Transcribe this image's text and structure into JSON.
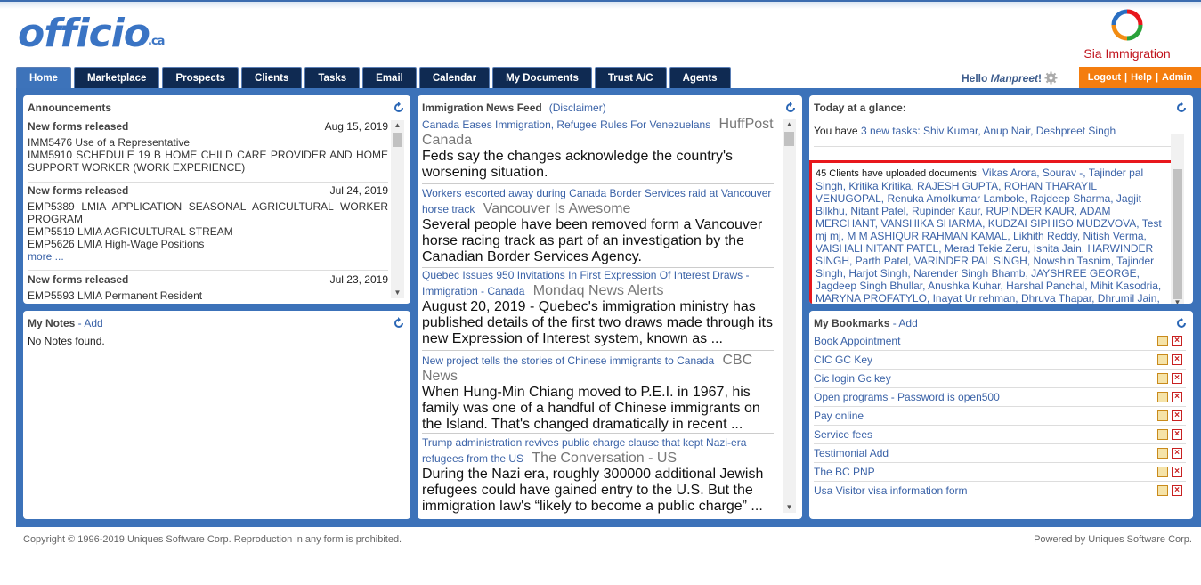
{
  "brand": {
    "logo": "officio",
    "logo_suffix": ".ca",
    "company": "Sia Immigration"
  },
  "nav": {
    "tabs": [
      "Home",
      "Marketplace",
      "Prospects",
      "Clients",
      "Tasks",
      "Email",
      "Calendar",
      "My Documents",
      "Trust A/C",
      "Agents"
    ],
    "active": "Home",
    "hello_prefix": "Hello ",
    "user": "Manpreet",
    "hello_suffix": "!",
    "logout": "Logout",
    "help": "Help",
    "admin": "Admin",
    "sep": "|"
  },
  "announcements": {
    "title": "Announcements",
    "items": [
      {
        "heading": "New forms released",
        "date": "Aug 15, 2019",
        "lines": [
          "IMM5476 Use of a Representative",
          "IMM5910 SCHEDULE 19 B HOME CHILD CARE PROVIDER AND HOME SUPPORT WORKER (WORK EXPERIENCE)"
        ]
      },
      {
        "heading": "New forms released",
        "date": "Jul 24, 2019",
        "lines": [
          "EMP5389 LMIA APPLICATION SEASONAL AGRICULTURAL WORKER PROGRAM",
          "EMP5519 LMIA AGRICULTURAL STREAM",
          "EMP5626 LMIA High-Wage Positions"
        ],
        "more": "more ..."
      },
      {
        "heading": "New forms released",
        "date": "Jul 23, 2019",
        "lines": [
          "EMP5593 LMIA Permanent Resident"
        ]
      }
    ]
  },
  "notes": {
    "title": "My Notes",
    "add": "Add",
    "dash": " - ",
    "empty": "No Notes found."
  },
  "news": {
    "title": "Immigration News Feed",
    "disclaimer": "(Disclaimer)",
    "items": [
      {
        "title": "Canada Eases Immigration, Refugee Rules For Venezuelans",
        "source": "HuffPost Canada",
        "body": "Feds say the changes acknowledge the country's worsening situation."
      },
      {
        "title": "Workers escorted away during Canada Border Services raid at Vancouver horse track",
        "source": "Vancouver Is Awesome",
        "body": "Several people have been removed form a Vancouver horse racing track as part of an investigation by the Canadian Border Services Agency."
      },
      {
        "title": "Quebec Issues 950 Invitations In First Expression Of Interest Draws - Immigration - Canada",
        "source": "Mondaq News Alerts",
        "body": "August 20, 2019 - Quebec's immigration ministry has published details of the first two draws made through its new Expression of Interest system, known as ..."
      },
      {
        "title": "New project tells the stories of Chinese immigrants to Canada",
        "source": "CBC News",
        "body": "When Hung-Min Chiang moved to P.E.I. in 1967, his family was one of a handful of Chinese immigrants on the Island. That's changed dramatically in recent ..."
      },
      {
        "title": "Trump administration revives public charge clause that kept Nazi-era refugees from the US",
        "source": "The Conversation - US",
        "body": "During the Nazi era, roughly 300000 additional Jewish refugees could have gained entry to the U.S. But the immigration law's “likely to become a public charge” ..."
      }
    ]
  },
  "glance": {
    "title": "Today at a glance:",
    "tasks_prefix": "You have ",
    "tasks_link": "3 new tasks:",
    "task_names": "Shiv Kumar, Anup Nair, Deshpreet Singh",
    "uploads_lead": "45 Clients have uploaded documents: ",
    "uploads_names": "Vikas Arora, Sourav -, Tajinder pal Singh, Kritika Kritika, RAJESH GUPTA, ROHAN THARAYIL VENUGOPAL, Renuka Amolkumar Lambole, Rajdeep Sharma, Jagjit Bilkhu, Nitant Patel, Rupinder Kaur, RUPINDER KAUR, ADAM MERCHANT, VANSHIKA SHARMA, KUDZAI SIPHISO MUDZVOVA, Test mj mj, M M ASHIQUR RAHMAN KAMAL, Likhith Reddy, Nitish Verma, VAISHALI NITANT PATEL, Merad Tekie Zeru, Ishita Jain, HARWINDER SINGH, Parth Patel, VARINDER PAL SINGH, Nowshin Tasnim, Tajinder Singh, Harjot Singh, Narender Singh Bhamb, JAYSHREE GEORGE, Jagdeep Singh Bhullar, Anushka Kuhar, Harshal Panchal, Mihit Kasodria, MARYNA PROFATYLO, Inayat Ur rehman, Dhruva Thapar, Dhrumil Jain, Lovepreet (amardeep) Kaur, Parul -, Shashank Mishra, Shiv Kumar, Anup Nair, Deshpreet Singh"
  },
  "bookmarks": {
    "title": "My Bookmarks",
    "add": "Add",
    "dash": " - ",
    "items": [
      "Book Appointment",
      "CIC GC Key",
      "Cic login Gc key",
      "Open programs - Password is open500",
      "Pay online",
      "Service fees",
      "Testimonial Add",
      "The BC PNP",
      "Usa Visitor visa information form"
    ]
  },
  "footer": {
    "copyright": "Copyright © 1996-2019 Uniques Software Corp.  Reproduction in any form is prohibited.",
    "powered": "Powered by Uniques Software Corp."
  },
  "colors": {
    "nav_dark": "#0f2a52",
    "nav_active": "#3d73ba",
    "frame": "#3c72b9",
    "orange": "#f47d0e",
    "link": "#3a62a7",
    "highlight": "#e8171c"
  },
  "icons": [
    "refresh-icon",
    "gear-icon",
    "edit-icon",
    "delete-icon",
    "scroll-up-icon",
    "scroll-down-icon"
  ]
}
